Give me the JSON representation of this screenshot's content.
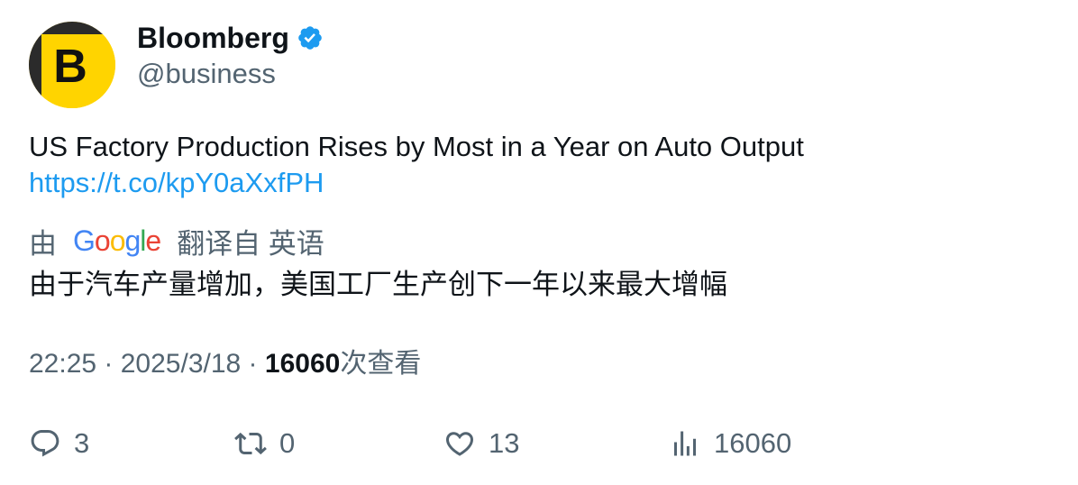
{
  "author": {
    "display_name": "Bloomberg",
    "handle": "@business",
    "avatar_letter": "B",
    "verified": true
  },
  "tweet": {
    "text": "US Factory Production Rises by Most in a Year on Auto Output",
    "link": "https://t.co/kpY0aXxfPH"
  },
  "translation": {
    "by_label": "由",
    "provider": "Google",
    "translated_from_label": "翻译自 英语",
    "text": "由于汽车产量增加，美国工厂生产创下一年以来最大增幅"
  },
  "meta": {
    "time": "22:25",
    "separator": " · ",
    "date": "2025/3/18",
    "views_count": "16060",
    "views_label": "次查看"
  },
  "actions": {
    "replies": "3",
    "retweets": "0",
    "likes": "13",
    "views": "16060"
  },
  "colors": {
    "accent": "#1d9bf0",
    "secondary_text": "#536471",
    "brand_yellow": "#ffd400"
  }
}
